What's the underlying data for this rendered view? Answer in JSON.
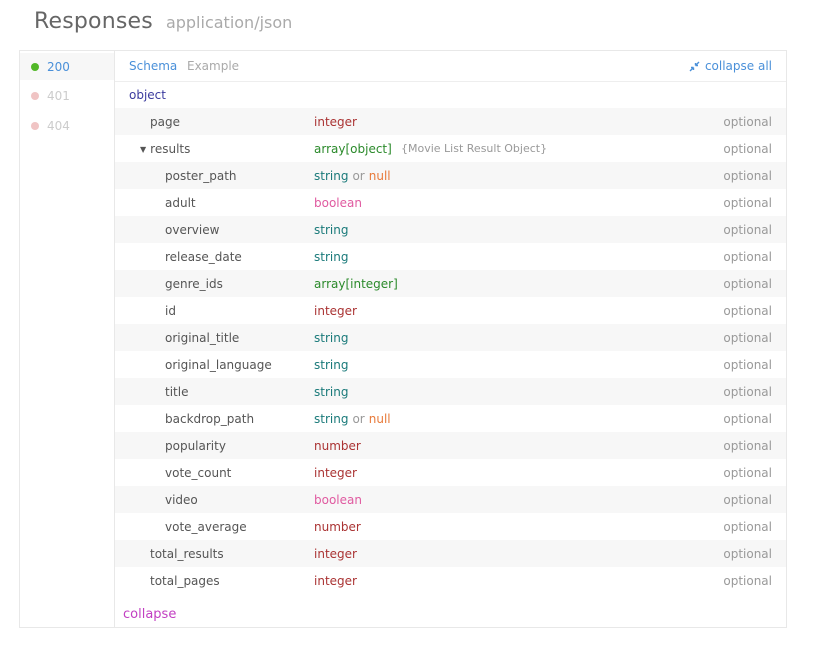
{
  "header": {
    "title": "Responses",
    "content_type": "application/json"
  },
  "status_codes": [
    {
      "code": "200",
      "color": "#52b828",
      "active": true
    },
    {
      "code": "401",
      "color": "#f0c4c4",
      "active": false
    },
    {
      "code": "404",
      "color": "#f0c4c4",
      "active": false
    }
  ],
  "tabs": {
    "schema": "Schema",
    "example": "Example",
    "collapse_all": "collapse all"
  },
  "schema": {
    "root_type": "object",
    "fields": [
      {
        "name": "page",
        "type": "integer",
        "optional": "optional"
      },
      {
        "name": "results",
        "type": "array[object]",
        "note": "{Movie List Result Object}",
        "optional": "optional",
        "expandable": true
      },
      {
        "name": "poster_path",
        "type": "string",
        "or": "or",
        "alt_type": "null",
        "optional": "optional",
        "child": true
      },
      {
        "name": "adult",
        "type": "boolean",
        "optional": "optional",
        "child": true
      },
      {
        "name": "overview",
        "type": "string",
        "optional": "optional",
        "child": true
      },
      {
        "name": "release_date",
        "type": "string",
        "optional": "optional",
        "child": true
      },
      {
        "name": "genre_ids",
        "type": "array[integer]",
        "optional": "optional",
        "child": true
      },
      {
        "name": "id",
        "type": "integer",
        "optional": "optional",
        "child": true
      },
      {
        "name": "original_title",
        "type": "string",
        "optional": "optional",
        "child": true
      },
      {
        "name": "original_language",
        "type": "string",
        "optional": "optional",
        "child": true
      },
      {
        "name": "title",
        "type": "string",
        "optional": "optional",
        "child": true
      },
      {
        "name": "backdrop_path",
        "type": "string",
        "or": "or",
        "alt_type": "null",
        "optional": "optional",
        "child": true
      },
      {
        "name": "popularity",
        "type": "number",
        "optional": "optional",
        "child": true
      },
      {
        "name": "vote_count",
        "type": "integer",
        "optional": "optional",
        "child": true
      },
      {
        "name": "video",
        "type": "boolean",
        "optional": "optional",
        "child": true
      },
      {
        "name": "vote_average",
        "type": "number",
        "optional": "optional",
        "child": true
      },
      {
        "name": "total_results",
        "type": "integer",
        "optional": "optional"
      },
      {
        "name": "total_pages",
        "type": "integer",
        "optional": "optional"
      }
    ],
    "collapse_label": "collapse"
  }
}
